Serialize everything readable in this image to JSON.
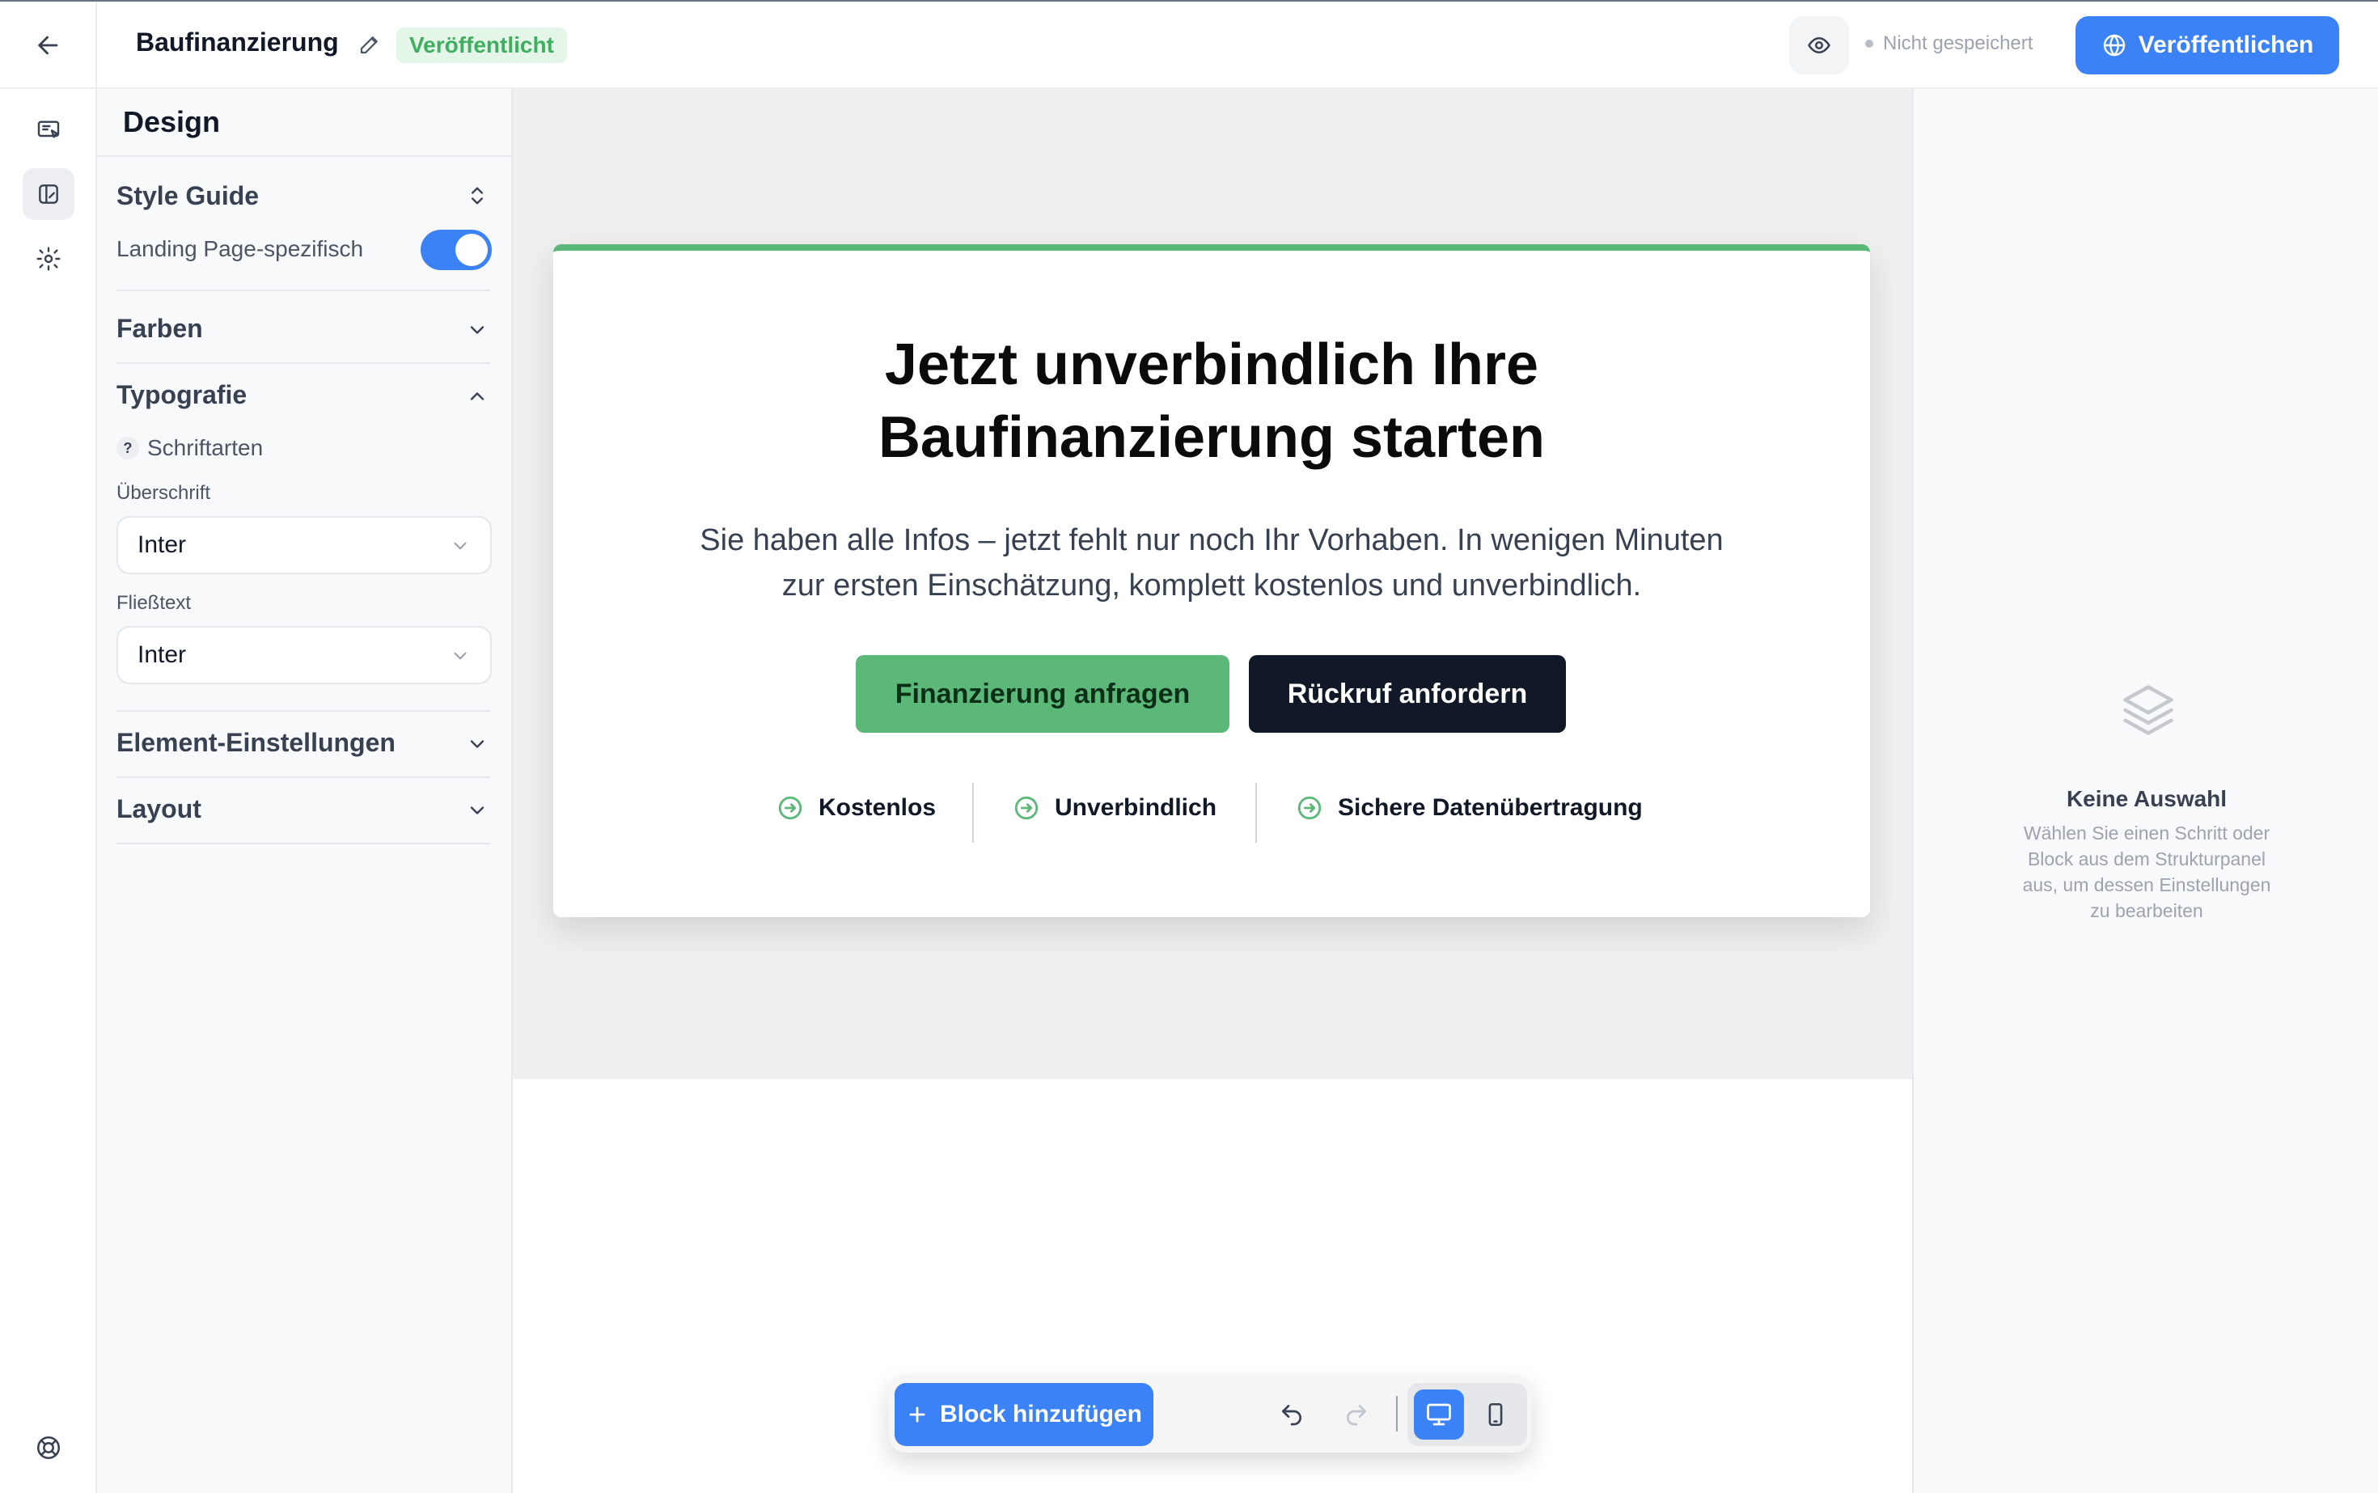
{
  "header": {
    "title": "Baufinanzierung",
    "status_badge": "Veröffentlicht",
    "save_status": "Nicht gespeichert",
    "publish_label": "Veröffentlichen"
  },
  "rail": {
    "icons": [
      "back-arrow-icon",
      "content-editor-icon",
      "design-panel-icon",
      "settings-gear-icon",
      "help-lifebuoy-icon"
    ]
  },
  "design_panel": {
    "title": "Design",
    "style_guide": {
      "title": "Style Guide",
      "toggle_label": "Landing Page-spezifisch",
      "toggle_on": true
    },
    "farben": {
      "title": "Farben"
    },
    "typografie": {
      "title": "Typografie",
      "help_label": "Schriftarten",
      "heading_label": "Überschrift",
      "heading_font": "Inter",
      "body_label": "Fließtext",
      "body_font": "Inter"
    },
    "element_settings": {
      "title": "Element-Einstellungen"
    },
    "layout": {
      "title": "Layout"
    }
  },
  "canvas": {
    "hero": {
      "title_line1": "Jetzt unverbindlich Ihre",
      "title_line2": "Baufinanzierung starten",
      "subtitle_line1": "Sie haben alle Infos – jetzt fehlt nur noch Ihr Vorhaben. In wenigen Minuten",
      "subtitle_line2": "zur ersten Einschätzung, komplett kostenlos und unverbindlich.",
      "primary_cta": "Finanzierung anfragen",
      "secondary_cta": "Rückruf anfordern",
      "benefits": [
        "Kostenlos",
        "Unverbindlich",
        "Sichere Datenübertragung"
      ],
      "accent_color": "#5cb878"
    }
  },
  "toolbar": {
    "add_block_label": "Block hinzufügen",
    "active_device": "desktop"
  },
  "right_panel": {
    "empty_title": "Keine Auswahl",
    "empty_line1": "Wählen Sie einen Schritt oder",
    "empty_line2": "Block aus dem Strukturpanel",
    "empty_line3": "aus, um dessen Einstellungen",
    "empty_line4": "zu bearbeiten"
  },
  "colors": {
    "primary_blue": "#3b82f6",
    "success_green": "#5cb878",
    "dark": "#111827"
  }
}
